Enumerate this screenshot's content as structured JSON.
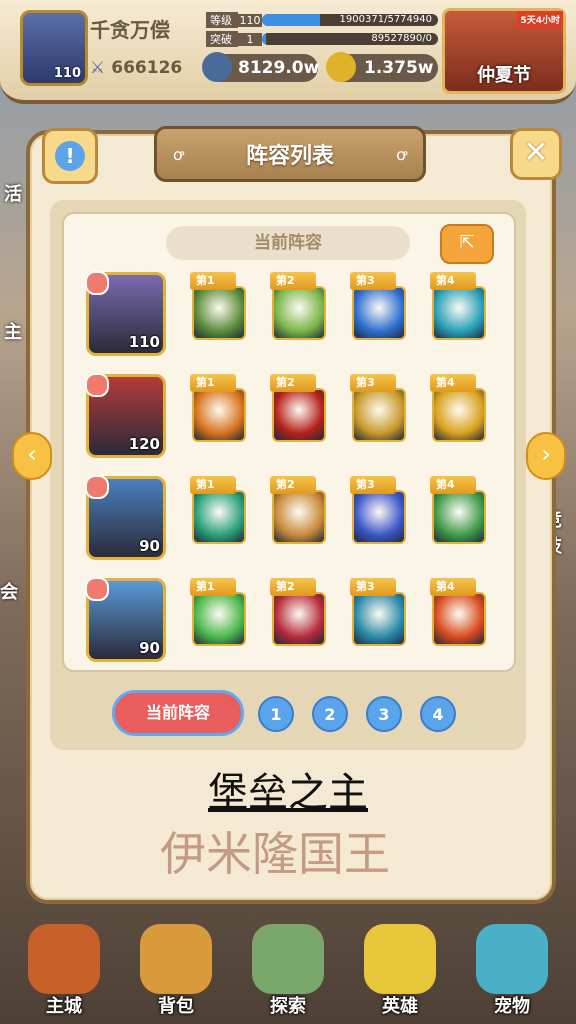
{
  "header": {
    "player_name": "千贪万偿",
    "player_level": "110",
    "combat_power": "666126",
    "bars": [
      {
        "label": "等级",
        "num": "110",
        "text": "1900371/5774940",
        "progress": 0.33
      },
      {
        "label": "突破",
        "num": "1",
        "text": "89527890/0",
        "progress": 0.02
      }
    ],
    "currency1": "8129.0w",
    "currency2": "1.375w",
    "event_label": "仲夏节",
    "event_tag": "5天4小时"
  },
  "panel": {
    "title": "阵容列表",
    "info_icon": "!",
    "close_icon": "✕",
    "current_label": "当前阵容",
    "share_icon": "⇱"
  },
  "rows": [
    {
      "level": "110",
      "color": "#7a6bb0",
      "skills": [
        {
          "tag": "第1",
          "color": "#5b8c3a"
        },
        {
          "tag": "第2",
          "color": "#7ab648"
        },
        {
          "tag": "第3",
          "color": "#2f6fd0"
        },
        {
          "tag": "第4",
          "color": "#2aa0b8"
        }
      ]
    },
    {
      "level": "120",
      "color": "#b23b3b",
      "skills": [
        {
          "tag": "第1",
          "color": "#d8731e"
        },
        {
          "tag": "第2",
          "color": "#b5221a"
        },
        {
          "tag": "第3",
          "color": "#c89a2a"
        },
        {
          "tag": "第4",
          "color": "#d9a21e"
        }
      ]
    },
    {
      "level": "90",
      "color": "#4a7fbf",
      "skills": [
        {
          "tag": "第1",
          "color": "#2aa07a"
        },
        {
          "tag": "第2",
          "color": "#c78a3a"
        },
        {
          "tag": "第3",
          "color": "#3b56c8"
        },
        {
          "tag": "第4",
          "color": "#3f9a4a"
        }
      ]
    },
    {
      "level": "90",
      "color": "#5a9ad8",
      "skills": [
        {
          "tag": "第1",
          "color": "#4ab84a"
        },
        {
          "tag": "第2",
          "color": "#b52a3a"
        },
        {
          "tag": "第3",
          "color": "#2a8aa8"
        },
        {
          "tag": "第4",
          "color": "#d84a1e"
        }
      ]
    }
  ],
  "tabs": {
    "main": "当前阵容",
    "numbers": [
      "1",
      "2",
      "3",
      "4"
    ]
  },
  "caption1": "堡垒之主",
  "caption2": "伊米隆国王",
  "nav": [
    {
      "label": "主城",
      "color": "#c8602a"
    },
    {
      "label": "背包",
      "color": "#d89a3a"
    },
    {
      "label": "探索",
      "color": "#7aa86a"
    },
    {
      "label": "英雄",
      "color": "#e8c83a"
    },
    {
      "label": "宠物",
      "color": "#4ab0c8"
    }
  ],
  "side_hints": [
    "活",
    "主",
    "会",
    "竞技"
  ]
}
